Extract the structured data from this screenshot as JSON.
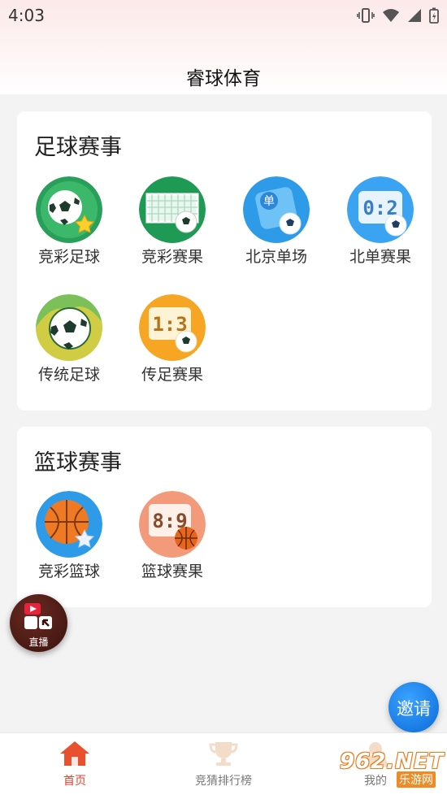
{
  "status": {
    "time": "4:03"
  },
  "header": {
    "title": "睿球体育"
  },
  "football": {
    "title": "足球赛事",
    "items": [
      {
        "label": "竞彩足球",
        "icon": "football-star-icon"
      },
      {
        "label": "竞彩赛果",
        "icon": "football-goal-icon"
      },
      {
        "label": "北京单场",
        "icon": "single-match-icon",
        "badge": "单"
      },
      {
        "label": "北单赛果",
        "icon": "scoreboard-icon",
        "score": "0:2"
      },
      {
        "label": "传统足球",
        "icon": "classic-football-icon"
      },
      {
        "label": "传足赛果",
        "icon": "classic-result-icon",
        "score": "1:3"
      }
    ]
  },
  "basketball": {
    "title": "篮球赛事",
    "items": [
      {
        "label": "竞彩篮球",
        "icon": "basketball-star-icon"
      },
      {
        "label": "篮球赛果",
        "icon": "basketball-result-icon",
        "score": "8:9"
      }
    ]
  },
  "live_fab": {
    "label": "直播"
  },
  "invite_fab": {
    "label": "邀请"
  },
  "tabs": [
    {
      "label": "首页",
      "active": true
    },
    {
      "label": "竞猜排行榜",
      "active": false
    },
    {
      "label": "我的",
      "active": false
    }
  ],
  "watermark": {
    "main": "962.NET",
    "sub": "乐游网"
  },
  "colors": {
    "accent": "#e0422a",
    "invite": "#1a7fe8",
    "background": "#f3f3f3"
  }
}
